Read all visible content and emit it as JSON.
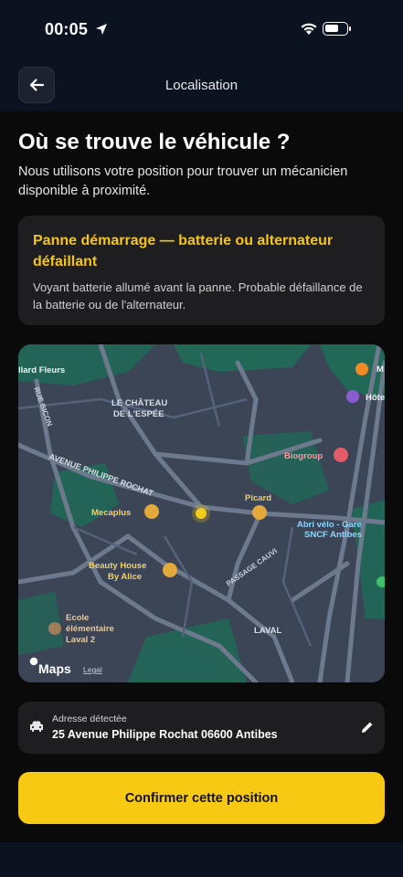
{
  "status_bar": {
    "time": "00:05"
  },
  "nav": {
    "title": "Localisation"
  },
  "page": {
    "title": "Où se trouve le véhicule ?",
    "subtitle": "Nous utilisons votre position pour trouver un mécanicien disponible à proximité."
  },
  "issue": {
    "title": "Panne démarrage — batterie ou alternateur défaillant",
    "description": "Voyant batterie allumé avant la panne. Probable défaillance de la batterie ou de l'alternateur."
  },
  "map": {
    "labels": {
      "fleurs": "llard Fleurs",
      "chateau_1": "LE CHÂTEAU",
      "chateau_2": "DE L'ESPÉE",
      "rue_bicon": "RUE BICON",
      "avenue": "AVENUE PHILIPPE ROCHAT",
      "hotel": "Hôte",
      "biogroup": "Biogroup",
      "picard": "Picard",
      "mecaplus": "Mecaplus",
      "abri_1": "Abri vélo - Gare",
      "abri_2": "SNCF Antibes",
      "beauty_1": "Beauty House",
      "beauty_2": "By Alice",
      "passage": "PASSAGE CAUVI",
      "ecole_1": "Ecole",
      "ecole_2": "élémentaire",
      "ecole_3": "Laval 2",
      "laval": "LAVAL",
      "maps_logo": "Maps",
      "legal": "Legal",
      "partial_m": "M"
    },
    "colors": {
      "land": "#3b4556",
      "green": "#1f6b57",
      "road": "#6d7a8e",
      "pin": "#f2cc1a"
    }
  },
  "address": {
    "label": "Adresse détectée",
    "value": "25 Avenue Philippe Rochat 06600 Antibes"
  },
  "actions": {
    "confirm_label": "Confirmer cette position"
  },
  "icons": [
    "location-arrow-icon",
    "wifi-icon",
    "battery-icon",
    "back-arrow-icon",
    "car-icon",
    "pencil-icon"
  ]
}
